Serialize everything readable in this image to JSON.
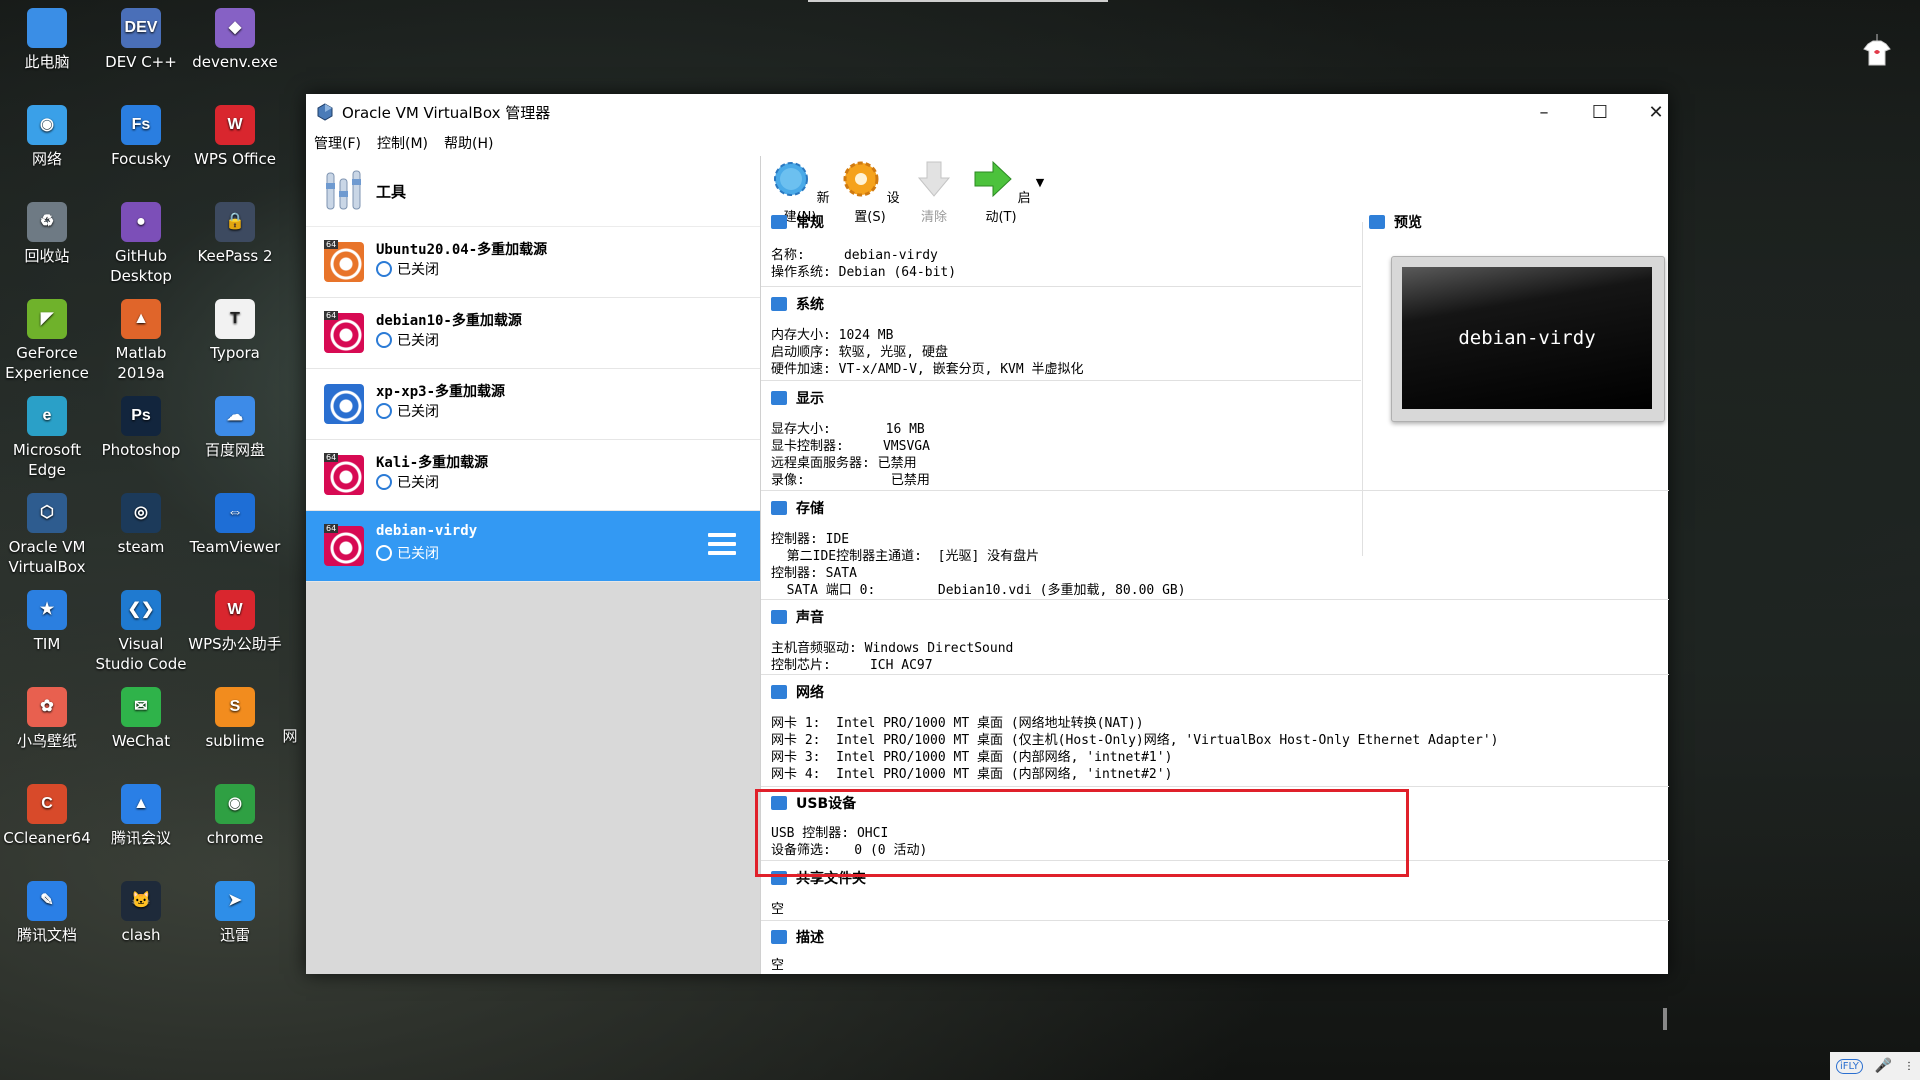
{
  "desktop": {
    "icons": [
      {
        "label": "此电脑",
        "glyph": "",
        "color": "#3a8ee6"
      },
      {
        "label": "DEV C++",
        "glyph": "DEV",
        "color": "#4a6fb8"
      },
      {
        "label": "devenv.exe",
        "glyph": "◆",
        "color": "#8661c5"
      },
      {
        "label": "网络",
        "glyph": "◉",
        "color": "#3aa0e8"
      },
      {
        "label": "Focusky",
        "glyph": "Fs",
        "color": "#2a7ee0"
      },
      {
        "label": "WPS Office",
        "glyph": "W",
        "color": "#d9262e"
      },
      {
        "label": "回收站",
        "glyph": "♻",
        "color": "#6e7a84"
      },
      {
        "label": "GitHub Desktop",
        "glyph": "●",
        "color": "#7c4fb8"
      },
      {
        "label": "KeePass 2",
        "glyph": "🔒",
        "color": "#3d4a60"
      },
      {
        "label": "GeForce Experience",
        "glyph": "◤",
        "color": "#6fb22b"
      },
      {
        "label": "Matlab 2019a",
        "glyph": "▲",
        "color": "#e0652a"
      },
      {
        "label": "Typora",
        "glyph": "T",
        "color": "#f2f2f2"
      },
      {
        "label": "Microsoft Edge",
        "glyph": "e",
        "color": "#2aa0c8"
      },
      {
        "label": "Photoshop",
        "glyph": "Ps",
        "color": "#12253d"
      },
      {
        "label": "百度网盘",
        "glyph": "☁",
        "color": "#3d8be8"
      },
      {
        "label": "Oracle VM VirtualBox",
        "glyph": "⬡",
        "color": "#2e5c8f"
      },
      {
        "label": "steam",
        "glyph": "◎",
        "color": "#1c3a5a"
      },
      {
        "label": "TeamViewer",
        "glyph": "⇔",
        "color": "#1e6ed6"
      },
      {
        "label": "TIM",
        "glyph": "★",
        "color": "#2b7fe0"
      },
      {
        "label": "Visual Studio Code",
        "glyph": "❮❯",
        "color": "#1f7ad0"
      },
      {
        "label": "WPS办公助手",
        "glyph": "W",
        "color": "#d9262e"
      },
      {
        "label": "小鸟壁纸",
        "glyph": "✿",
        "color": "#e8604f"
      },
      {
        "label": "WeChat",
        "glyph": "✉",
        "color": "#2fb34a"
      },
      {
        "label": "sublime",
        "glyph": "S",
        "color": "#f28c1e"
      },
      {
        "label": "CCleaner64",
        "glyph": "C",
        "color": "#d84a2a"
      },
      {
        "label": "腾讯会议",
        "glyph": "▲",
        "color": "#2a7fe6"
      },
      {
        "label": "chrome",
        "glyph": "◉",
        "color": "#2fa043"
      },
      {
        "label": "腾讯文档",
        "glyph": "✎",
        "color": "#2a7fe6"
      },
      {
        "label": "clash",
        "glyph": "🐱",
        "color": "#1e2a3a"
      },
      {
        "label": "迅雷",
        "glyph": "➤",
        "color": "#2e8ee8"
      }
    ],
    "partial_label": "网"
  },
  "window": {
    "title": "Oracle VM VirtualBox 管理器",
    "menu": [
      "管理(F)",
      "控制(M)",
      "帮助(H)"
    ],
    "controls": {
      "minimize": "–",
      "maximize": "☐",
      "close": "✕"
    }
  },
  "left": {
    "tools_label": "工具",
    "vms": [
      {
        "name": "Ubuntu20.04-多重加载源",
        "state": "已关闭",
        "badge": "64",
        "os_color": "#e8742a",
        "selected": false
      },
      {
        "name": "debian10-多重加载源",
        "state": "已关闭",
        "badge": "64",
        "os_color": "#d70a53",
        "selected": false
      },
      {
        "name": "xp-xp3-多重加载源",
        "state": "已关闭",
        "badge": "",
        "os_color": "#2a6fd0",
        "selected": false
      },
      {
        "name": "Kali-多重加载源",
        "state": "已关闭",
        "badge": "64",
        "os_color": "#d70a53",
        "selected": false
      },
      {
        "name": "debian-virdy",
        "state": "已关闭",
        "badge": "64",
        "os_color": "#d70a53",
        "selected": true
      }
    ]
  },
  "toolbar": {
    "new_label": "新建(N)",
    "settings_label": "设置(S)",
    "remove_label": "清除",
    "start_label": "启动(T)"
  },
  "details": {
    "general": {
      "title": "常规",
      "lines": [
        "名称:     debian-virdy",
        "操作系统: Debian (64-bit)"
      ]
    },
    "preview": {
      "title": "预览",
      "screen_text": "debian-virdy"
    },
    "system": {
      "title": "系统",
      "lines": [
        "内存大小: 1024 MB",
        "启动顺序: 软驱, 光驱, 硬盘",
        "硬件加速: VT-x/AMD-V, 嵌套分页, KVM 半虚拟化"
      ]
    },
    "display": {
      "title": "显示",
      "lines": [
        "显存大小:       16 MB",
        "显卡控制器:     VMSVGA",
        "远程桌面服务器: 已禁用",
        "录像:           已禁用"
      ]
    },
    "storage": {
      "title": "存储",
      "lines": [
        "控制器: IDE",
        "  第二IDE控制器主通道:  [光驱] 没有盘片",
        "控制器: SATA",
        "  SATA 端口 0:        Debian10.vdi (多重加载, 80.00 GB)"
      ]
    },
    "audio": {
      "title": "声音",
      "lines": [
        "主机音频驱动: Windows DirectSound",
        "控制芯片:     ICH AC97"
      ]
    },
    "network": {
      "title": "网络",
      "lines": [
        "网卡 1:  Intel PRO/1000 MT 桌面 (网络地址转换(NAT))",
        "网卡 2:  Intel PRO/1000 MT 桌面 (仅主机(Host-Only)网络, 'VirtualBox Host-Only Ethernet Adapter')",
        "网卡 3:  Intel PRO/1000 MT 桌面 (内部网络, 'intnet#1')",
        "网卡 4:  Intel PRO/1000 MT 桌面 (内部网络, 'intnet#2')"
      ]
    },
    "usb": {
      "title": "USB设备",
      "lines": [
        "USB 控制器: OHCI",
        "设备筛选:   0 (0 活动)"
      ]
    },
    "shared": {
      "title": "共享文件夹",
      "lines": [
        "空"
      ]
    },
    "description": {
      "title": "描述",
      "lines": [
        "空"
      ]
    }
  },
  "tray": {
    "ime": "iFLY",
    "mic": "🎤"
  },
  "colors": {
    "selection": "#3399f3",
    "highlight_border": "#e0202a",
    "section_icon": "#2f7fd8"
  }
}
